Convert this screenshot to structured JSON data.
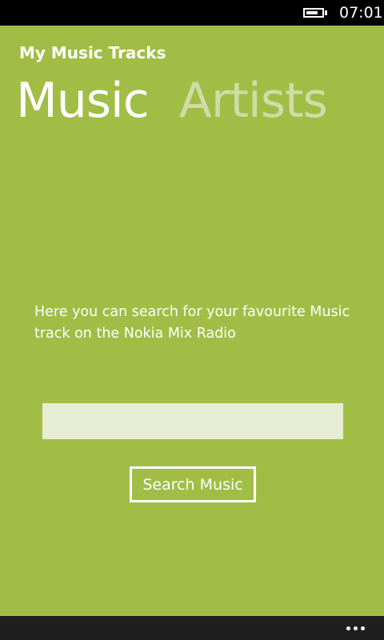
{
  "status_bar": {
    "time": "07:01",
    "battery_level": 0.75
  },
  "app": {
    "title": "My Music Tracks",
    "background_color": "#a2bd45"
  },
  "pivot": {
    "items": [
      {
        "label": "Music",
        "active": true
      },
      {
        "label": "Artists",
        "active": false
      }
    ]
  },
  "music_page": {
    "description": "Here you can search for your favourite Music track on the Nokia Mix Radio",
    "search_input_value": "",
    "search_button_label": "Search Music"
  },
  "app_bar": {
    "more_icon": "more-dots-icon"
  }
}
